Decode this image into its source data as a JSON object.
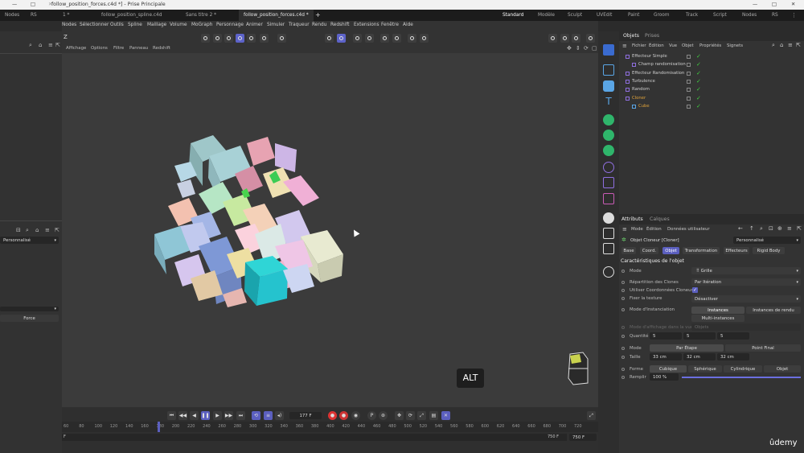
{
  "window": {
    "title": "follow_position_forces.c4d *] - Prise Principale",
    "controls": [
      "—",
      "□",
      "✕"
    ]
  },
  "tabs": {
    "left_stub": "Nodes",
    "left_stub2": "RS",
    "items": [
      "1 *",
      "follow_position_spline.c4d",
      "Sans titre 2 *",
      "follow_position_forces.c4d *"
    ],
    "add": "+",
    "layouts": [
      "Standard",
      "Modèle",
      "Sculpt",
      "UVEdit",
      "Paint",
      "Groom",
      "Track",
      "Script",
      "Nodes",
      "RS"
    ]
  },
  "menubar": [
    "Nodes",
    "Sélectionner",
    "Outils",
    "Spline",
    "Maillage",
    "Volume",
    "MoGraph",
    "Personnage",
    "Animer",
    "Simuler",
    "Traqueur",
    "Rendu",
    "Redshift",
    "Extensions",
    "Fenêtre",
    "Aide"
  ],
  "toolbar_left": "Z",
  "viewport_menu": [
    "Affichage",
    "Options",
    "Filtre",
    "Panneau",
    "Redshift"
  ],
  "left_panel": {
    "dropdown1": "Personnalisé",
    "button": "Force"
  },
  "viewport": {
    "alt_badge": "ALT"
  },
  "timeline": {
    "current_frame": "177 F",
    "ticks": [
      "60",
      "80",
      "100",
      "120",
      "140",
      "160",
      "180",
      "200",
      "220",
      "240",
      "260",
      "280",
      "300",
      "320",
      "340",
      "360",
      "380",
      "400",
      "420",
      "440",
      "460",
      "480",
      "500",
      "520",
      "540",
      "560",
      "580",
      "600",
      "620",
      "640",
      "660",
      "680",
      "700",
      "720"
    ],
    "start_label": "F",
    "end_field": "750 F",
    "end_field2": "750 F",
    "playhead_frame": 177,
    "range": [
      50,
      730
    ]
  },
  "objects_panel": {
    "tabs": [
      "Objets",
      "Prises"
    ],
    "menu": [
      "Fichier",
      "Édition",
      "Vue",
      "Objet",
      "Propriétés",
      "Signets"
    ],
    "rows": [
      {
        "label": "Effecteur Simple",
        "indent": 0,
        "color": "#cfcfcf"
      },
      {
        "label": "Champ randomisation",
        "indent": 1,
        "color": "#cfcfcf"
      },
      {
        "label": "Effecteur Randomisation",
        "indent": 0,
        "color": "#cfcfcf"
      },
      {
        "label": "Turbulence",
        "indent": 0,
        "color": "#cfcfcf"
      },
      {
        "label": "Random",
        "indent": 0,
        "color": "#cfcfcf"
      },
      {
        "label": "Cloner",
        "indent": 0,
        "color": "#e2a43a"
      },
      {
        "label": "Cube",
        "indent": 1,
        "color": "#e2a43a"
      }
    ]
  },
  "attributes_panel": {
    "tabs": [
      "Attributs",
      "Calques"
    ],
    "menu": [
      "Mode",
      "Édition",
      "Données utilisateur"
    ],
    "object_name": "Objet Cloneur [Cloner]",
    "preset": "Personnalisé",
    "subtabs": [
      "Base",
      "Coord.",
      "Objet",
      "Transformation",
      "Effecteurs",
      "Rigid Body"
    ],
    "active_subtab": "Objet",
    "section_title": "Caractéristiques de l'objet",
    "mode_label": "Mode",
    "mode_value": "Grille",
    "repartition_label": "Répartition des Clones",
    "repartition_value": "Par Itération",
    "utiliser_label": "Utiliser Coordonnées Cloneur",
    "fixer_label": "Fixer la texture",
    "fixer_value": "Désactiver",
    "instanciation_label": "Mode d'Instanciation",
    "instanciation_options": [
      "Instances",
      "Instances de rendu",
      "Multi-instances"
    ],
    "affichage_label": "Mode d'affichage dans la vue",
    "affichage_value": "Objets",
    "quantite_label": "Quantité",
    "quantite_values": [
      "5",
      "5",
      "5"
    ],
    "mode2_label": "Mode",
    "mode2_options": [
      "Par Étape",
      "Point Final"
    ],
    "taille_label": "Taille",
    "taille_values": [
      "33 cm",
      "32 cm",
      "32 cm"
    ],
    "forme_label": "Forme",
    "forme_options": [
      "Cubique",
      "Sphérique",
      "Cylindrique",
      "Objet"
    ],
    "remplir_label": "Remplir",
    "remplir_value": "100 %",
    "remplir_level": 1.0
  },
  "watermark": "ûdemy"
}
